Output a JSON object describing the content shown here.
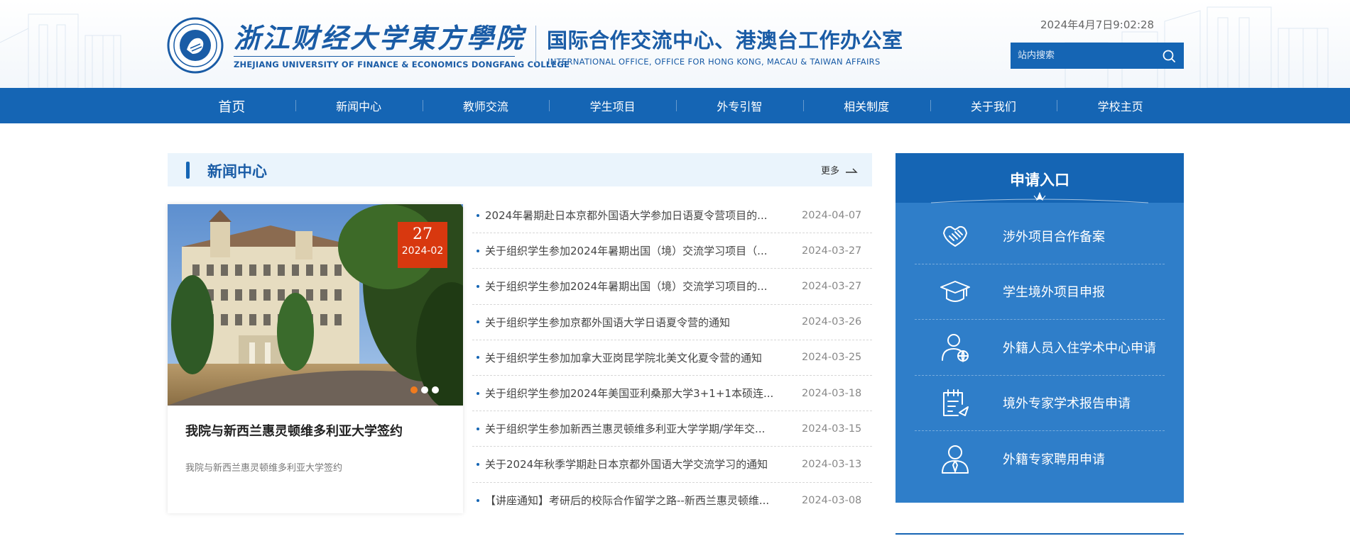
{
  "header": {
    "logo_cn": "浙江财经大学東方學院",
    "logo_en": "ZHEJIANG UNIVERSITY OF FINANCE & ECONOMICS DONGFANG COLLEGE",
    "office_cn": "国际合作交流中心、港澳台工作办公室",
    "office_en": "INTERNATIONAL OFFICE, OFFICE FOR HONG KONG, MACAU & TAIWAN AFFAIRS",
    "datetime": "2024年4月7日9:02:28",
    "search_placeholder": "站内搜索",
    "search_icon": "search-icon"
  },
  "nav": {
    "items": [
      "首页",
      "新闻中心",
      "教师交流",
      "学生项目",
      "外专引智",
      "相关制度",
      "关于我们",
      "学校主页"
    ]
  },
  "news": {
    "section_title": "新闻中心",
    "more_label": "更多",
    "feature": {
      "day": "27",
      "year_month": "2024-02",
      "title": "我院与新西兰惠灵顿维多利亚大学签约",
      "desc": "我院与新西兰惠灵顿维多利亚大学签约",
      "slides": 3,
      "active_slide": 1
    },
    "items": [
      {
        "title": "2024年暑期赴日本京都外国语大学参加日语夏令营项目的...",
        "date": "2024-04-07"
      },
      {
        "title": "关于组织学生参加2024年暑期出国（境）交流学习项目（...",
        "date": "2024-03-27"
      },
      {
        "title": "关于组织学生参加2024年暑期出国（境）交流学习项目的...",
        "date": "2024-03-27"
      },
      {
        "title": "关于组织学生参加京都外国语大学日语夏令营的通知",
        "date": "2024-03-26"
      },
      {
        "title": "关于组织学生参加加拿大亚岗昆学院北美文化夏令营的通知",
        "date": "2024-03-25"
      },
      {
        "title": "关于组织学生参加2024年美国亚利桑那大学3+1+1本硕连...",
        "date": "2024-03-18"
      },
      {
        "title": "关于组织学生参加新西兰惠灵顿维多利亚大学学期/学年交...",
        "date": "2024-03-15"
      },
      {
        "title": "关于2024年秋季学期赴日本京都外国语大学交流学习的通知",
        "date": "2024-03-13"
      },
      {
        "title": "【讲座通知】考研后的校际合作留学之路--新西兰惠灵顿维...",
        "date": "2024-03-08"
      }
    ]
  },
  "apply": {
    "title": "申请入口",
    "items": [
      {
        "label": "涉外项目合作备案",
        "icon": "handshake-icon"
      },
      {
        "label": "学生境外项目申报",
        "icon": "graduation-cap-icon"
      },
      {
        "label": "外籍人员入住学术中心申请",
        "icon": "person-globe-icon"
      },
      {
        "label": "境外专家学术报告申请",
        "icon": "clipboard-send-icon"
      },
      {
        "label": "外籍专家聘用申请",
        "icon": "person-tie-icon"
      }
    ]
  },
  "colors": {
    "primary": "#1565b4",
    "panel": "#2f7ec9",
    "badge": "#d8380f",
    "dot_active": "#f07b1e",
    "light_bg": "#eaf4fc"
  }
}
